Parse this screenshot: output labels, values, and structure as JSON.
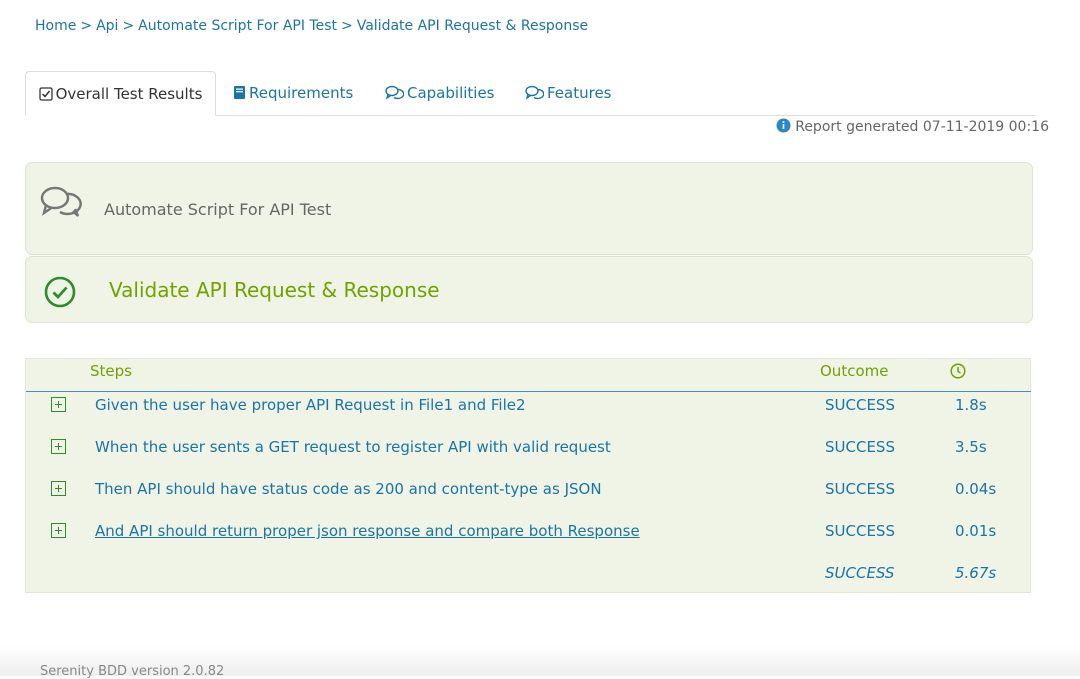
{
  "breadcrumb": {
    "items": [
      "Home",
      "Api",
      "Automate Script For API Test",
      "Validate API Request & Response"
    ],
    "separator": ">"
  },
  "tabs": [
    {
      "label": "Overall Test Results",
      "icon": "checkbox-icon",
      "active": true
    },
    {
      "label": "Requirements",
      "icon": "book-icon",
      "active": false
    },
    {
      "label": "Capabilities",
      "icon": "comments-icon",
      "active": false
    },
    {
      "label": "Features",
      "icon": "comments-icon",
      "active": false
    }
  ],
  "report": {
    "text": "Report generated 07-11-2019 00:16",
    "icon": "info-icon"
  },
  "feature": {
    "title": "Automate Script For API Test",
    "icon": "comments-icon"
  },
  "scenario": {
    "title": "Validate API Request & Response",
    "icon": "check-circle-icon",
    "color": "#72a100"
  },
  "steps": {
    "headers": {
      "steps": "Steps",
      "outcome": "Outcome",
      "duration_icon": "clock-icon"
    },
    "rows": [
      {
        "description": "Given the user have proper API Request in File1 and File2",
        "outcome": "SUCCESS",
        "duration": "1.8s"
      },
      {
        "description": "When the user sents a GET request to register API with valid request",
        "outcome": "SUCCESS",
        "duration": "3.5s"
      },
      {
        "description": "Then API should have status code as 200 and content-type as JSON",
        "outcome": "SUCCESS",
        "duration": "0.04s"
      },
      {
        "description": "And API should return proper json response and compare both Response",
        "outcome": "SUCCESS",
        "duration": "0.01s"
      }
    ],
    "total": {
      "outcome": "SUCCESS",
      "duration": "5.67s"
    }
  },
  "footer": {
    "text": "Serenity BDD version 2.0.82"
  },
  "colors": {
    "link": "#1a74a8",
    "success": "#72a100",
    "panel_bg": "#f0f4e6"
  }
}
